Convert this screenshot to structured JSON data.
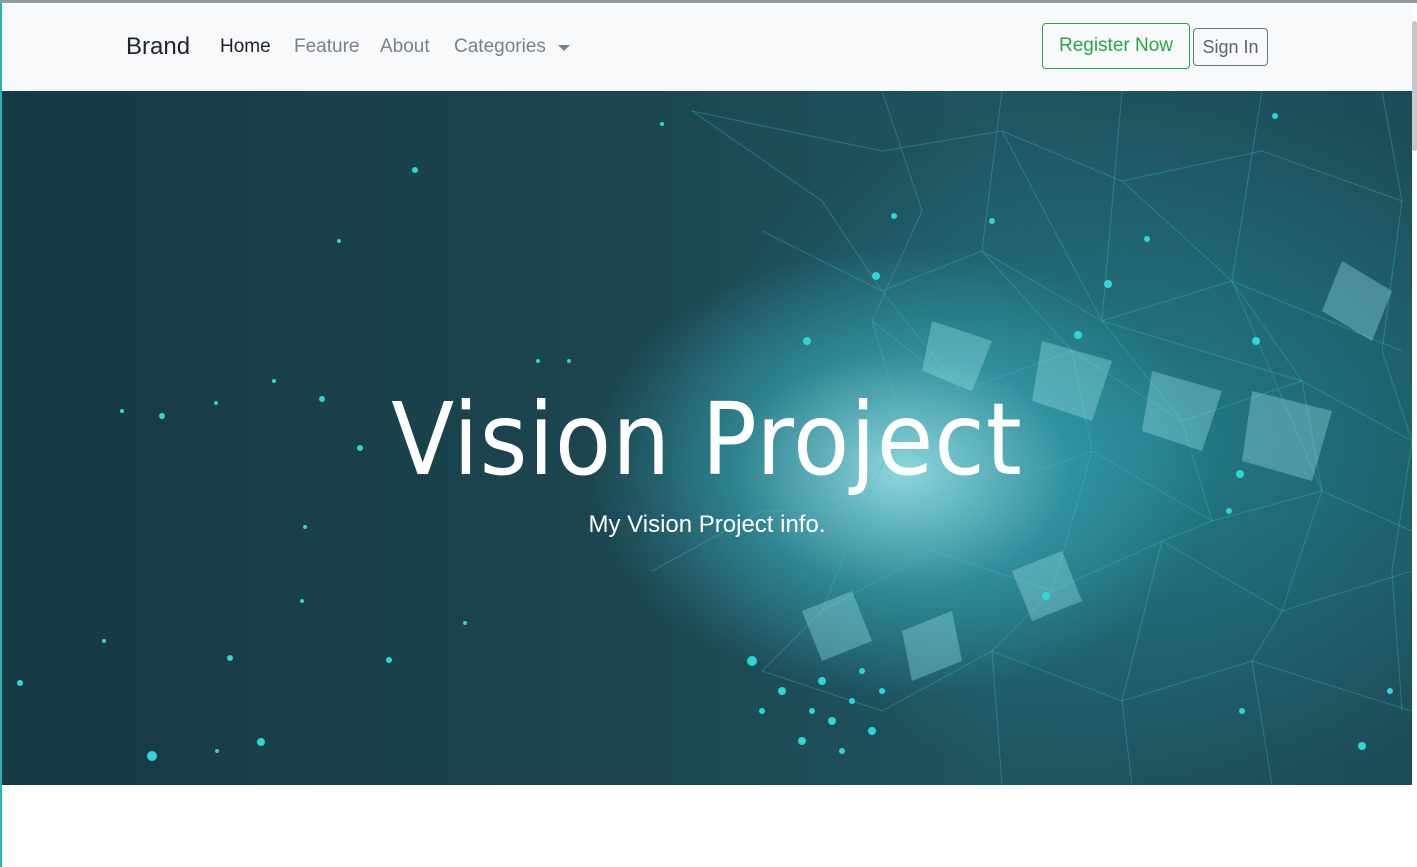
{
  "navbar": {
    "brand": "Brand",
    "links": [
      {
        "label": "Home",
        "active": true
      },
      {
        "label": "Feature",
        "active": false
      },
      {
        "label": "About",
        "active": false
      },
      {
        "label": "Categories",
        "active": false,
        "dropdown": true
      }
    ],
    "register_label": "Register Now",
    "signin_label": "Sign In"
  },
  "hero": {
    "title": "Vision Project",
    "subtitle": "My Vision Project info."
  },
  "colors": {
    "navbar_bg": "#f8f9fa",
    "register_accent": "#28a745",
    "hero_bg": "#1c4650",
    "particle": "#2fd6d6"
  },
  "icons": {
    "dropdown": "caret-down-icon"
  }
}
